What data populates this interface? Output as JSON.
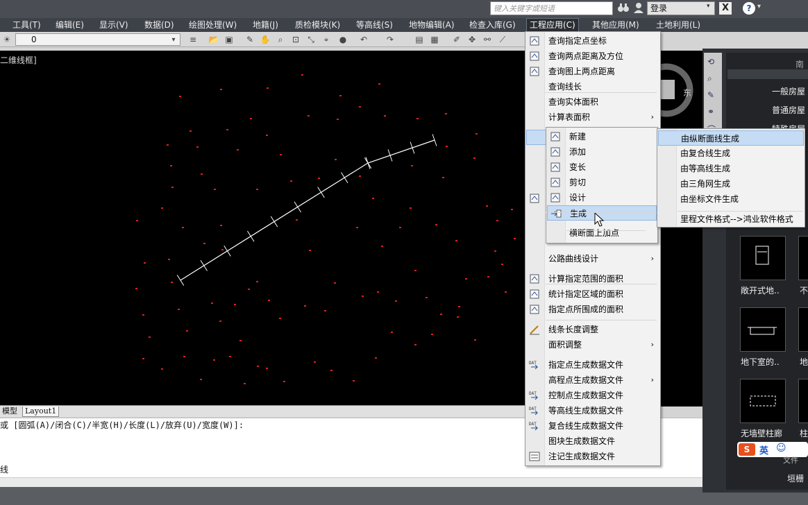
{
  "search": {
    "placeholder": "键入关键字或短语"
  },
  "login": {
    "label": "登录"
  },
  "menubar": {
    "items": [
      "工具(T)",
      "编辑(E)",
      "显示(V)",
      "数据(D)",
      "绘图处理(W)",
      "地籍(J)",
      "质检模块(K)",
      "等高线(S)",
      "地物编辑(A)",
      "检查入库(G)",
      "工程应用(C)",
      "其他应用(M)",
      "土地利用(L)"
    ],
    "active": "工程应用(C)"
  },
  "layer": {
    "value": "0"
  },
  "viewport": {
    "label": "二维线框]"
  },
  "compass": {
    "east": "东",
    "south": "南"
  },
  "tabs": {
    "model": "模型",
    "layout": "Layout1"
  },
  "command": {
    "line1": "或 [圆弧(A)/闭合(C)/半宽(H)/长度(L)/放弃(U)/宽度(W)]:",
    "line2": "线"
  },
  "main_menu": {
    "items": [
      {
        "label": "查询指定点坐标",
        "icon": "point-coord-icon"
      },
      {
        "label": "查询两点距离及方位",
        "icon": "distance-icon"
      },
      {
        "label": "查询图上两点距离",
        "icon": "map-distance-icon"
      },
      {
        "label": "查询线长",
        "icon": ""
      },
      {
        "label": "查询实体面积",
        "icon": ""
      },
      {
        "label": "计算表面积",
        "icon": "",
        "submenu": true
      },
      {
        "label": "",
        "icon": "",
        "highlight": true
      },
      {
        "label": "",
        "icon": ""
      },
      {
        "label": "",
        "icon": ""
      },
      {
        "label": "",
        "icon": ""
      },
      {
        "label": "",
        "icon": "section-icon"
      },
      {
        "label": "",
        "icon": ""
      },
      {
        "label": "",
        "icon": ""
      },
      {
        "label": "公路曲线设计",
        "icon": "",
        "submenu": true
      },
      {
        "label": "计算指定范围的面积",
        "icon": "area-range-icon"
      },
      {
        "label": "统计指定区域的面积",
        "icon": "area-stat-icon"
      },
      {
        "label": "指定点所围成的面积",
        "icon": "area-points-icon"
      },
      {
        "label": "线条长度调整",
        "icon": "line-adjust-icon"
      },
      {
        "label": "面积调整",
        "icon": "",
        "submenu": true
      },
      {
        "label": "指定点生成数据文件",
        "icon": "dat-icon"
      },
      {
        "label": "高程点生成数据文件",
        "icon": "",
        "submenu": true
      },
      {
        "label": "控制点生成数据文件",
        "icon": "dat-icon"
      },
      {
        "label": "等高线生成数据文件",
        "icon": "dat-icon"
      },
      {
        "label": "复合线生成数据文件",
        "icon": "dat-icon"
      },
      {
        "label": "图块生成数据文件",
        "icon": ""
      },
      {
        "label": "注记生成数据文件",
        "icon": "note-icon"
      }
    ]
  },
  "sub_menu": {
    "items": [
      {
        "label": "新建",
        "icon": "new-icon"
      },
      {
        "label": "添加",
        "icon": "add-icon"
      },
      {
        "label": "变长",
        "icon": "lengthen-icon"
      },
      {
        "label": "剪切",
        "icon": "cut-icon"
      },
      {
        "label": "设计",
        "icon": "design-icon"
      },
      {
        "label": "生成",
        "icon": "generate-icon",
        "highlight": true
      },
      {
        "label": "横断面上加点",
        "icon": ""
      }
    ]
  },
  "sub_sub_menu": {
    "items": [
      {
        "label": "由纵断面线生成",
        "highlight": true
      },
      {
        "label": "由复合线生成"
      },
      {
        "label": "由等高线生成"
      },
      {
        "label": "由三角网生成"
      },
      {
        "label": "由坐标文件生成"
      },
      {
        "label": "里程文件格式-->鸿业软件格式"
      }
    ]
  },
  "right_panel": {
    "labels": [
      "一般房屋",
      "普通房屋",
      "特殊房屋"
    ],
    "blocks": [
      {
        "label": "敞开式地.."
      },
      {
        "label": "不"
      },
      {
        "label": "地下室的.."
      },
      {
        "label": "地"
      },
      {
        "label": "无墙壁柱廊"
      },
      {
        "label": "柱"
      }
    ],
    "footer": [
      "文件",
      "垣栅"
    ]
  },
  "ime": {
    "label": "英"
  },
  "colors": {
    "canvas": "#000000",
    "points": "#e02020",
    "polyline": "#ffffff",
    "highlight": "#c6dcf5"
  }
}
